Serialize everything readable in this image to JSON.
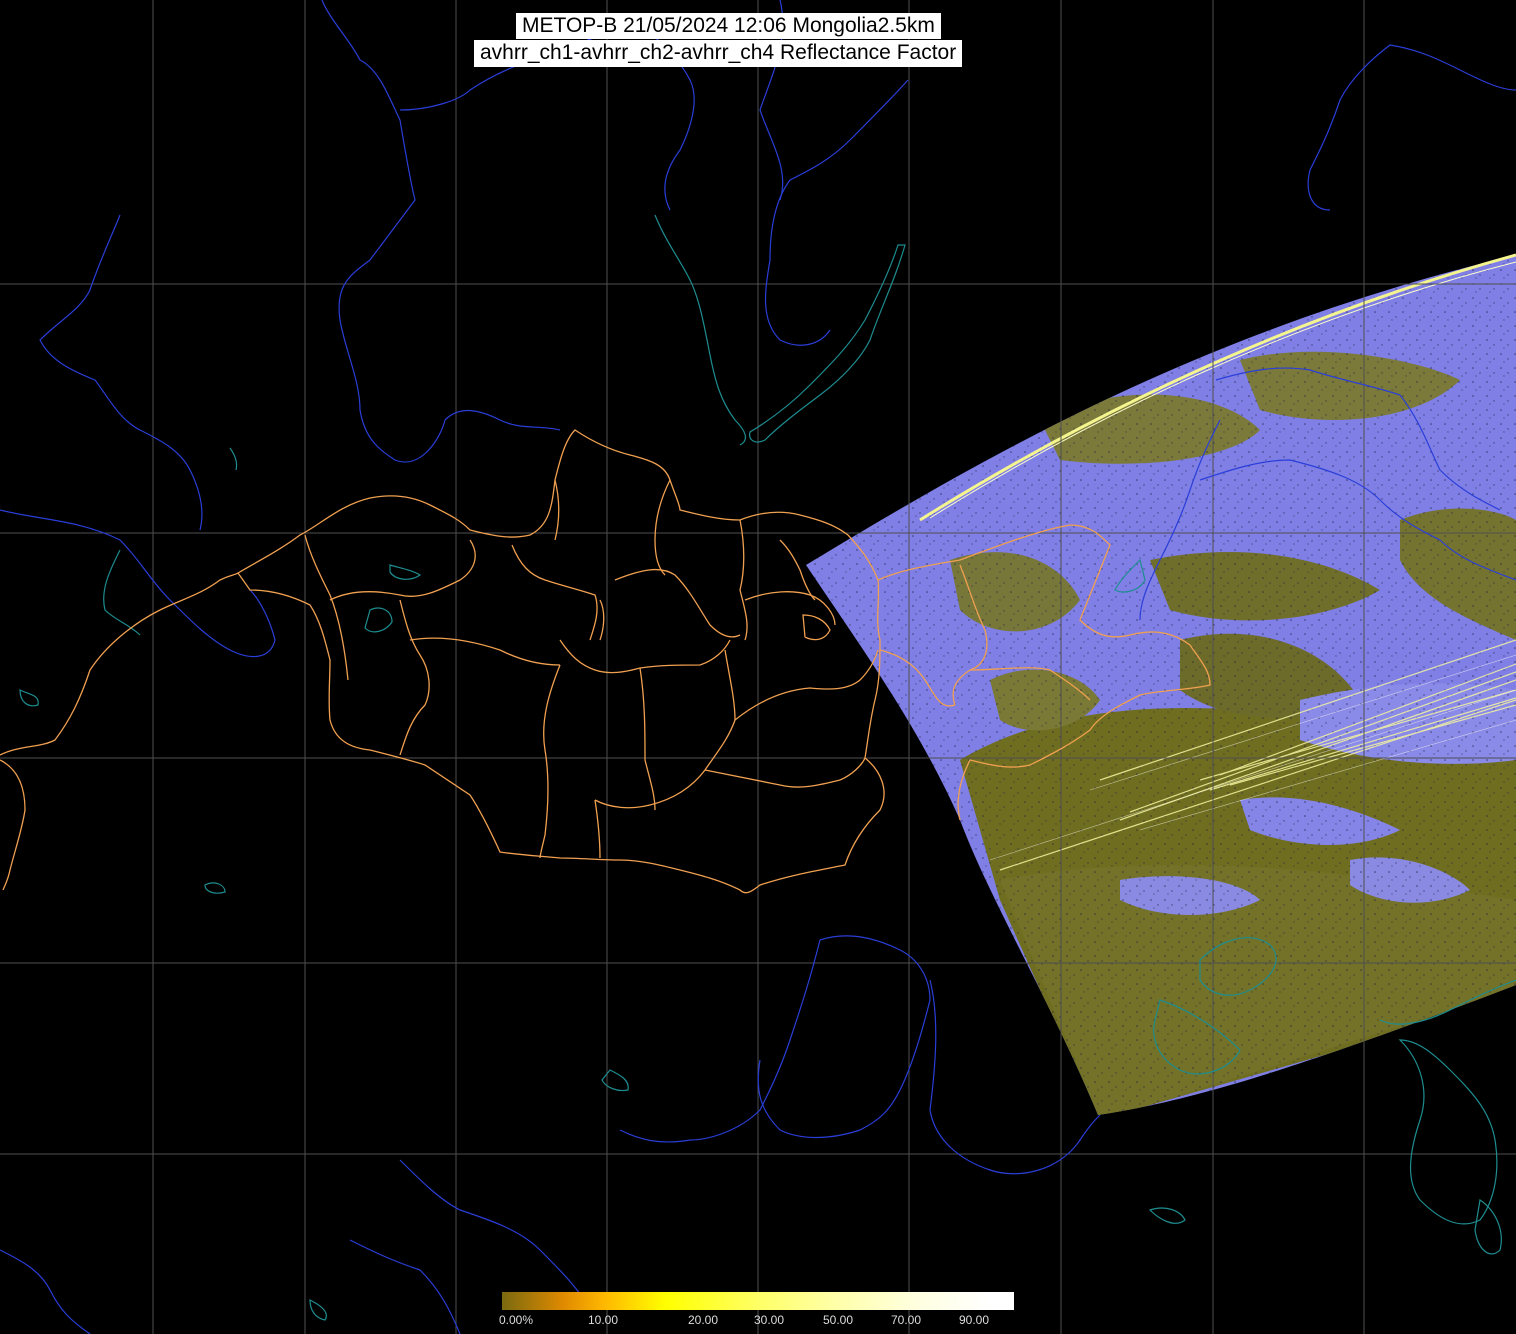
{
  "title": {
    "line1": "METOP-B 21/05/2024 12:06 Mongolia2.5km",
    "line2": "avhrr_ch1-avhrr_ch2-avhrr_ch4 Reflectance Factor"
  },
  "legend": {
    "labels": [
      "0.00%",
      "10.00",
      "20.00",
      "30.00",
      "50.00",
      "70.00",
      "90.00"
    ]
  },
  "colors": {
    "background": "#000000",
    "grid": "#555555",
    "rivers": "#2b3fd6",
    "lakes_coast": "#1d8a8f",
    "mongolia_borders": "#f0a050",
    "swath_low": "#6b6b1e",
    "swath_cloud": "#8080f0",
    "swath_edge": "#f5f5a0"
  },
  "icons": [
    "map-graticule",
    "satellite-swath",
    "colour-scale-bar"
  ]
}
